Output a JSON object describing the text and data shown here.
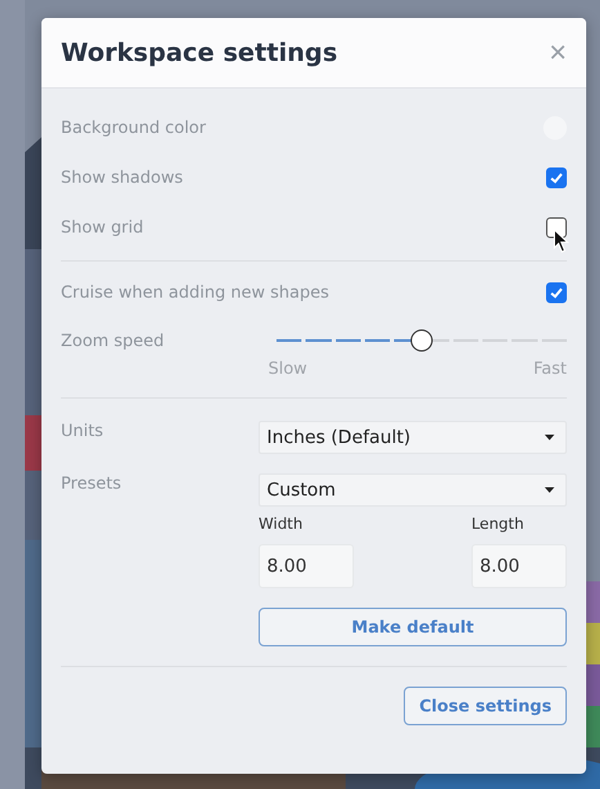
{
  "dialog": {
    "title": "Workspace settings",
    "close_icon": "×"
  },
  "group_1": [
    {
      "kind": "color",
      "label": "Background color"
    },
    {
      "kind": "checkbox",
      "label": "Show shadows",
      "checked": true
    },
    {
      "kind": "checkbox",
      "label": "Show grid",
      "checked": false
    }
  ],
  "group_2": [
    {
      "kind": "checkbox",
      "label": "Cruise when adding new shapes",
      "checked": true
    },
    {
      "kind": "slider",
      "label": "Zoom speed",
      "level": 0.5,
      "min_label": "Slow",
      "max_label": "Fast"
    }
  ],
  "units": {
    "label": "Units",
    "value": "Inches (Default)"
  },
  "presets": {
    "label": "Presets",
    "value": "Custom"
  },
  "width": {
    "label": "Width",
    "value": "8.00"
  },
  "length": {
    "label": "Length",
    "value": "8.00"
  },
  "make_default_button": "Make default",
  "close_button": "Close settings"
}
